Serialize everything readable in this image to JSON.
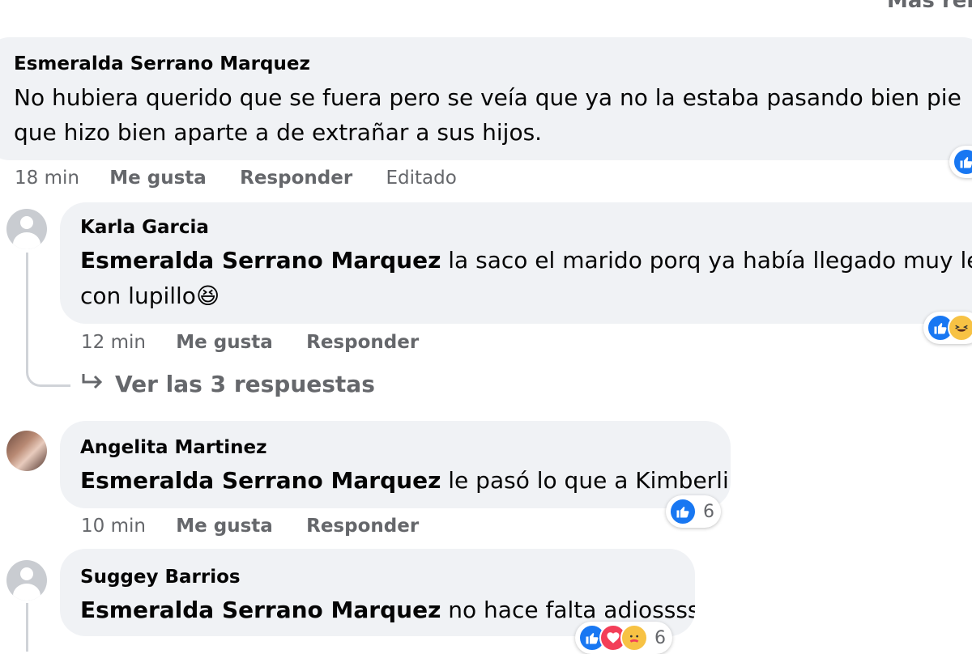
{
  "top_link": "Más rel",
  "comments": [
    {
      "author": "Esmeralda Serrano Marquez",
      "text_line1": "No hubiera querido que se fuera pero se veía que ya no la estaba pasando bien pie",
      "text_line2": "que hizo bien aparte a de extrañar a sus hijos.",
      "time": "18 min",
      "like_label": "Me gusta",
      "reply_label": "Responder",
      "edited_label": "Editado",
      "reactions": [
        "like-icon"
      ]
    },
    {
      "author": "Karla Garcia",
      "mention": "Esmeralda Serrano Marquez",
      "text_line1": " la saco el marido porq ya había llegado muy lej",
      "text_line2": "con lupillo",
      "emoji": "😆",
      "time": "12 min",
      "like_label": "Me gusta",
      "reply_label": "Responder",
      "reactions": [
        "like-icon",
        "haha-icon"
      ]
    },
    {
      "author": "Angelita Martinez",
      "mention": "Esmeralda Serrano Marquez",
      "text": " le pasó lo que a Kimberli",
      "time": "10 min",
      "like_label": "Me gusta",
      "reply_label": "Responder",
      "reaction_count": "6",
      "reactions": [
        "like-icon"
      ]
    },
    {
      "author": "Suggey Barrios",
      "mention": "Esmeralda Serrano Marquez",
      "text": " no hace falta adiossss",
      "reaction_count": "6",
      "reactions": [
        "like-icon",
        "love-icon",
        "care-icon"
      ]
    }
  ],
  "view_replies": "Ver las 3 respuestas",
  "colors": {
    "bubble": "#f0f2f5",
    "muted_text": "#65676b",
    "like_blue": "#1877f2",
    "love_red": "#f33e58",
    "haha_yellow": "#f7c244"
  }
}
